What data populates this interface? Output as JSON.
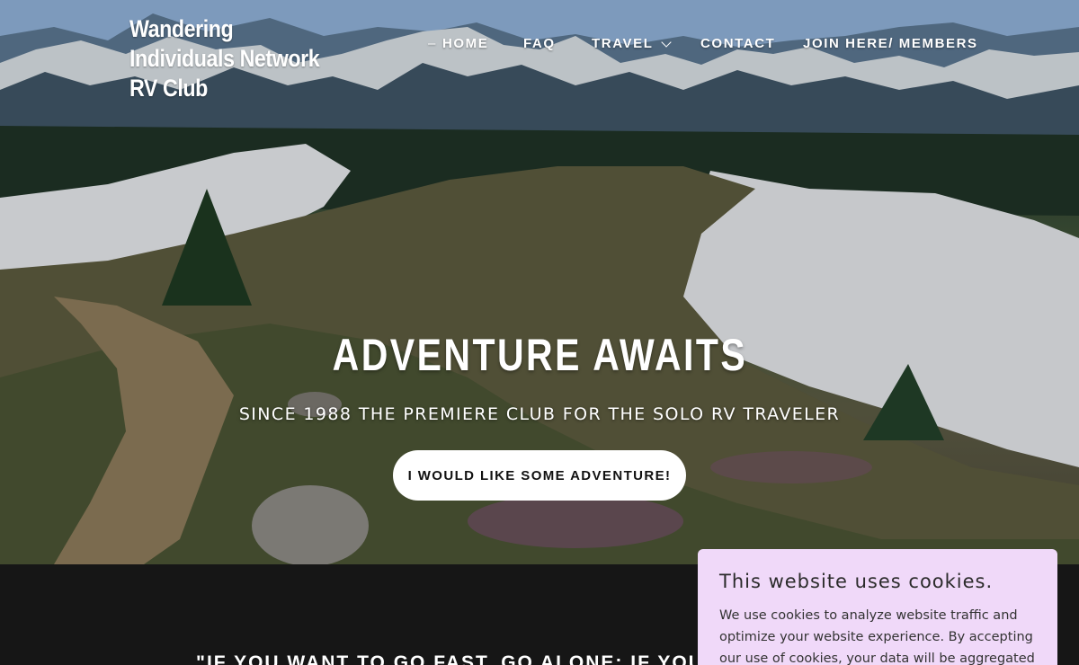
{
  "header": {
    "logo_text": "Wandering Individuals Network RV Club",
    "nav": [
      {
        "label": "HOME",
        "active": true
      },
      {
        "label": "FAQ"
      },
      {
        "label": "TRAVEL",
        "has_dropdown": true
      },
      {
        "label": "CONTACT"
      },
      {
        "label": "JOIN HERE/ MEMBERS"
      }
    ],
    "active_marker": "–"
  },
  "hero": {
    "title": "ADVENTURE AWAITS",
    "subtitle": "SINCE 1988 THE PREMIERE CLUB FOR THE SOLO RV TRAVELER",
    "cta_label": "I WOULD LIKE SOME ADVENTURE!"
  },
  "quote": {
    "text": "\"IF YOU WANT TO GO FAST, GO ALONE; IF YOU WANT TO GO"
  },
  "cookie_banner": {
    "title": "This website uses cookies.",
    "body": "We use cookies to analyze website traffic and optimize your website experience. By accepting our use of cookies, your data will be aggregated with all"
  },
  "colors": {
    "cookie_bg": "#f0d9f9",
    "dark_section": "#161616",
    "cta_bg": "#ffffff"
  }
}
